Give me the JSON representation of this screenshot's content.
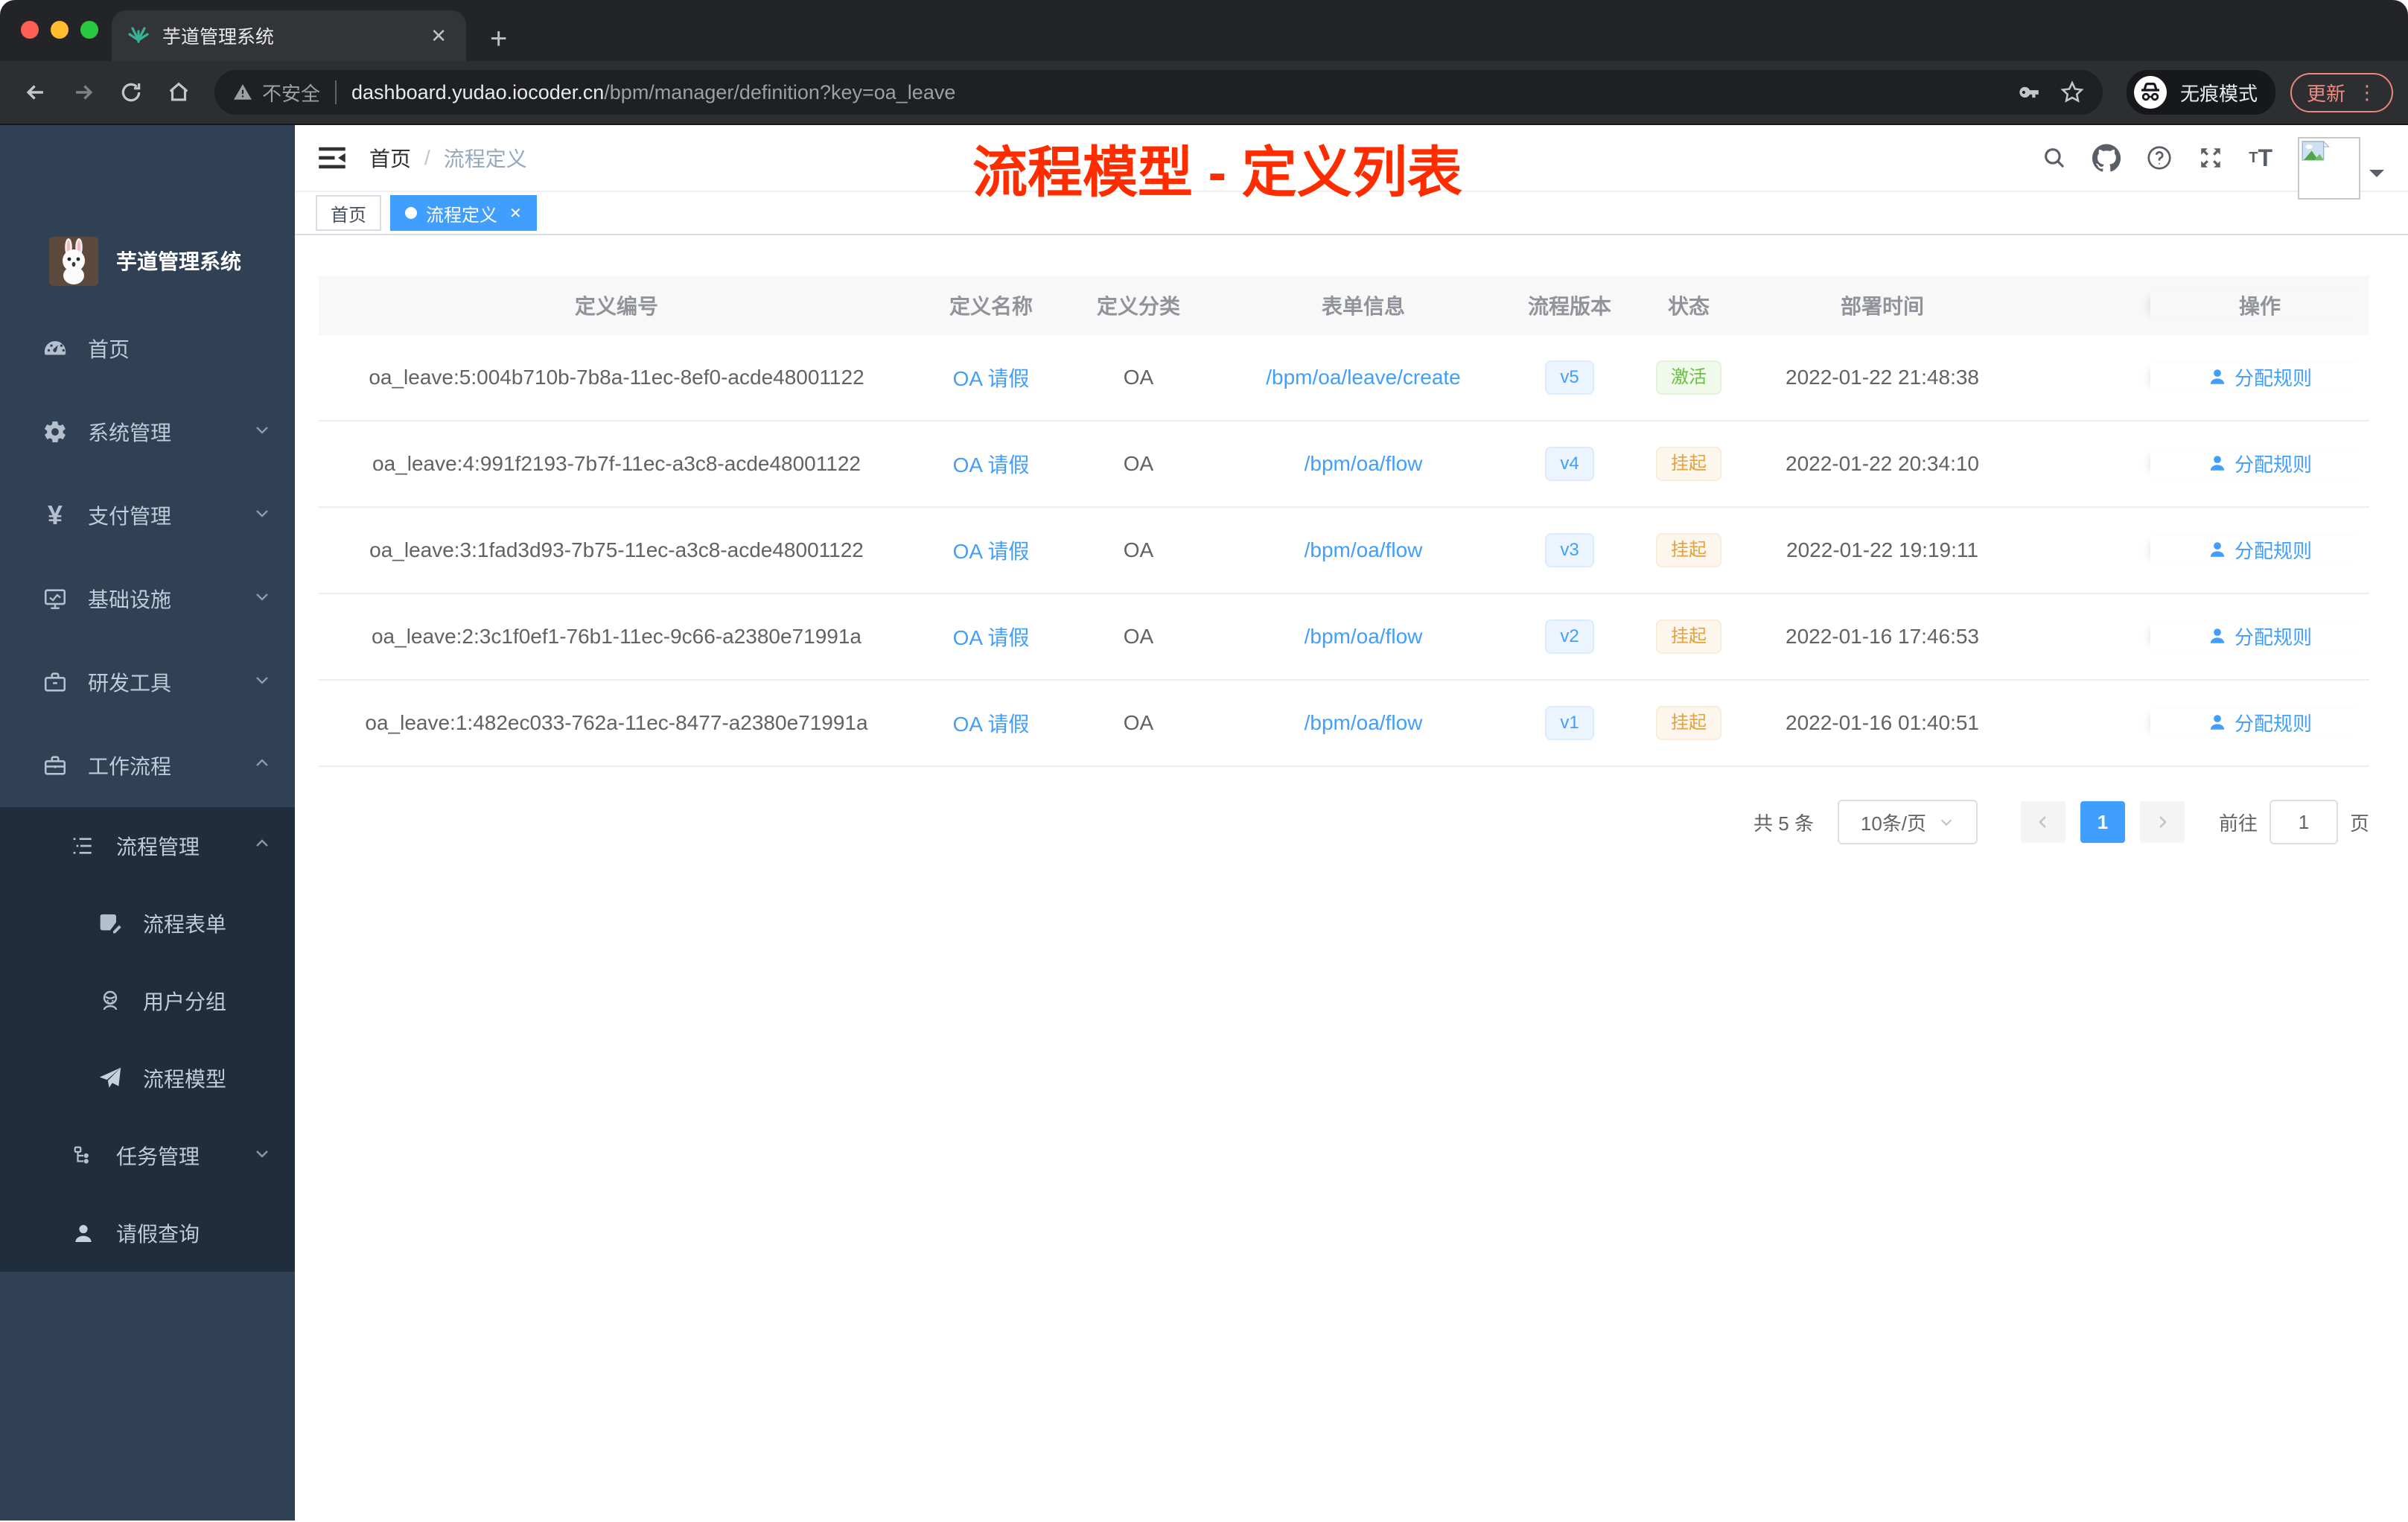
{
  "browser": {
    "tab_title": "芋道管理系统",
    "tab_close": "✕",
    "new_tab": "+",
    "security_label": "不安全",
    "url_host": "dashboard.yudao.iocoder.cn",
    "url_path": "/bpm/manager/definition?key=oa_leave",
    "incognito_label": "无痕模式",
    "update_label": "更新",
    "kebab": "⋮"
  },
  "sidebar": {
    "logo_title": "芋道管理系统",
    "items": [
      {
        "label": "首页"
      },
      {
        "label": "系统管理"
      },
      {
        "label": "支付管理"
      },
      {
        "label": "基础设施"
      },
      {
        "label": "研发工具"
      },
      {
        "label": "工作流程"
      }
    ],
    "workflow_children": {
      "process_mgmt": {
        "label": "流程管理"
      },
      "process_form": {
        "label": "流程表单"
      },
      "user_group": {
        "label": "用户分组"
      },
      "process_model": {
        "label": "流程模型"
      },
      "task_mgmt": {
        "label": "任务管理"
      },
      "leave_query": {
        "label": "请假查询"
      }
    }
  },
  "header": {
    "breadcrumb_home": "首页",
    "breadcrumb_sep": "/",
    "breadcrumb_current": "流程定义",
    "annotation": "流程模型 - 定义列表"
  },
  "tags": {
    "home": "首页",
    "current": "流程定义",
    "close": "✕"
  },
  "table": {
    "columns": {
      "id": "定义编号",
      "name": "定义名称",
      "category": "定义分类",
      "form": "表单信息",
      "version": "流程版本",
      "status": "状态",
      "deploy_time": "部署时间",
      "op": "操作"
    },
    "action_label": "分配规则",
    "rows": [
      {
        "id": "oa_leave:5:004b710b-7b8a-11ec-8ef0-acde48001122",
        "name": "OA 请假",
        "category": "OA",
        "form": "/bpm/oa/leave/create",
        "version": "v5",
        "status": "激活",
        "deploy_time": "2022-01-22 21:48:38"
      },
      {
        "id": "oa_leave:4:991f2193-7b7f-11ec-a3c8-acde48001122",
        "name": "OA 请假",
        "category": "OA",
        "form": "/bpm/oa/flow",
        "version": "v4",
        "status": "挂起",
        "deploy_time": "2022-01-22 20:34:10"
      },
      {
        "id": "oa_leave:3:1fad3d93-7b75-11ec-a3c8-acde48001122",
        "name": "OA 请假",
        "category": "OA",
        "form": "/bpm/oa/flow",
        "version": "v3",
        "status": "挂起",
        "deploy_time": "2022-01-22 19:19:11"
      },
      {
        "id": "oa_leave:2:3c1f0ef1-76b1-11ec-9c66-a2380e71991a",
        "name": "OA 请假",
        "category": "OA",
        "form": "/bpm/oa/flow",
        "version": "v2",
        "status": "挂起",
        "deploy_time": "2022-01-16 17:46:53"
      },
      {
        "id": "oa_leave:1:482ec033-762a-11ec-8477-a2380e71991a",
        "name": "OA 请假",
        "category": "OA",
        "form": "/bpm/oa/flow",
        "version": "v1",
        "status": "挂起",
        "deploy_time": "2022-01-16 01:40:51"
      }
    ]
  },
  "pagination": {
    "total": "共 5 条",
    "page_size": "10条/页",
    "current_page": "1",
    "goto_label": "前往",
    "goto_value": "1",
    "page_unit": "页"
  },
  "colors": {
    "accent_blue": "#409eff",
    "status_active_green": "#67c23a",
    "status_suspend_orange": "#e6a23c",
    "annotation_red": "#ff2c00",
    "sidebar_bg": "#304156",
    "submenu_bg": "#1f2d3d"
  }
}
